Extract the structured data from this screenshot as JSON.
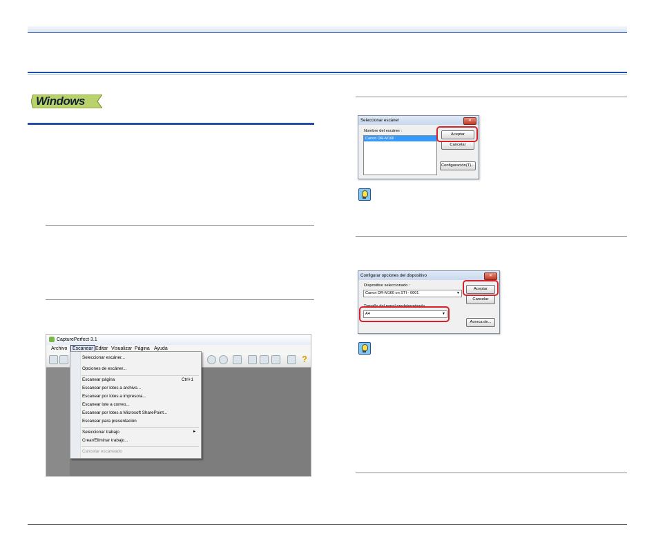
{
  "badge": {
    "label": "Windows"
  },
  "app": {
    "title": "CapturePerfect 3.1",
    "menu": [
      "Archivo",
      "Escanear",
      "Editar",
      "Visualizar",
      "Página",
      "Ayuda"
    ],
    "dropdown": {
      "items": [
        {
          "label": "Seleccionar escáner...",
          "shortcut": ""
        },
        {
          "label": "Opciones de escáner...",
          "shortcut": ""
        },
        {
          "label": "Escanear página",
          "shortcut": "Ctrl+1"
        },
        {
          "label": "Escanear por lotes a archivo...",
          "shortcut": ""
        },
        {
          "label": "Escanear por lotes a impresora...",
          "shortcut": ""
        },
        {
          "label": "Escanear lote a correo...",
          "shortcut": ""
        },
        {
          "label": "Escanear por lotes a Microsoft SharePoint...",
          "shortcut": ""
        },
        {
          "label": "Escanear para presentación",
          "shortcut": ""
        },
        {
          "label": "Seleccionar trabajo",
          "shortcut": "▸"
        },
        {
          "label": "Crear/Eliminar trabajo...",
          "shortcut": ""
        },
        {
          "label": "Cancelar escaneado",
          "shortcut": ""
        }
      ]
    }
  },
  "dialog1": {
    "title": "Seleccionar escáner",
    "list_label": "Nombre del escáner :",
    "selected_item": "Canon DR-M160",
    "ok": "Aceptar",
    "cancel": "Cancelar",
    "config": "Configuración(T)..."
  },
  "dialog2": {
    "title": "Configurar opciones del dispositivo",
    "device_label": "Dispositivo seleccionado :",
    "device_value": "Canon DR-M160 on STI - 0001",
    "size_label": "Tamaño del papel predeterminado",
    "size_value": "A4",
    "ok": "Aceptar",
    "cancel": "Cancelar",
    "about": "Acerca de..."
  },
  "colors": {
    "accent": "#1f4ea3",
    "highlight": "#d6202a",
    "selection": "#3399ff"
  }
}
